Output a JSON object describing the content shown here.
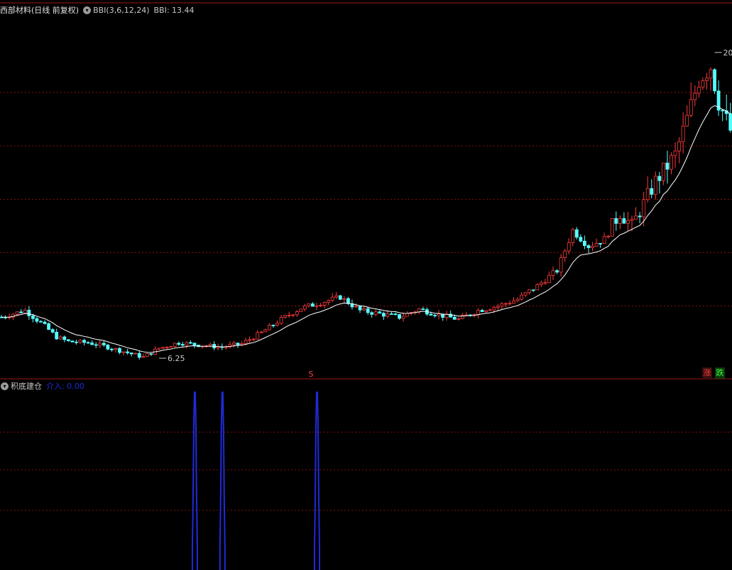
{
  "header": {
    "stock_title": "西部材料(日线 前复权)",
    "indicator_name": "BBI(3,6,12,24)",
    "indicator_value": "BBI: 13.44",
    "dropdown_icon": "chevron-down-icon"
  },
  "subpanel": {
    "title": "积底建仓",
    "legend": "介入: 0.00",
    "dropdown_icon": "chevron-down-icon"
  },
  "annotations": {
    "high_label": "20",
    "low_label": "6.25",
    "signal_marker": "S"
  },
  "footer_tags": {
    "rise": "涨",
    "fall": "跌"
  },
  "colors": {
    "background": "#000000",
    "up_candle": "#ff3b3b",
    "down_candle": "#54ffff",
    "bbi_line": "#ffffff",
    "grid": "#8b1010",
    "signal_bars": "#1e2bd8"
  },
  "chart_data": {
    "type": "candlestick",
    "indicator": "BBI",
    "price_range": [
      5.9,
      21.4
    ],
    "price_gridlines": [
      8.6,
      11.0,
      13.4,
      15.8,
      18.2
    ],
    "high": 20.0,
    "low": 6.25,
    "close_profile": [
      [
        0,
        8.1
      ],
      [
        6,
        8.4
      ],
      [
        11,
        7.7
      ],
      [
        14,
        7.2
      ],
      [
        17,
        7.0
      ],
      [
        22,
        6.95
      ],
      [
        26,
        6.8
      ],
      [
        31,
        6.55
      ],
      [
        36,
        6.3
      ],
      [
        40,
        6.7
      ],
      [
        45,
        6.95
      ],
      [
        50,
        6.85
      ],
      [
        56,
        6.75
      ],
      [
        61,
        6.9
      ],
      [
        66,
        7.4
      ],
      [
        71,
        8.0
      ],
      [
        76,
        8.5
      ],
      [
        81,
        8.75
      ],
      [
        86,
        9.0
      ],
      [
        91,
        8.4
      ],
      [
        96,
        8.25
      ],
      [
        101,
        8.1
      ],
      [
        106,
        8.45
      ],
      [
        111,
        8.2
      ],
      [
        116,
        8.0
      ],
      [
        121,
        8.4
      ],
      [
        126,
        8.6
      ],
      [
        131,
        8.9
      ],
      [
        136,
        9.5
      ],
      [
        141,
        10.2
      ],
      [
        145,
        12.0
      ],
      [
        149,
        11.3
      ],
      [
        153,
        11.6
      ],
      [
        157,
        12.8
      ],
      [
        160,
        12.2
      ],
      [
        163,
        13.2
      ],
      [
        166,
        14.2
      ],
      [
        169,
        14.9
      ],
      [
        171,
        15.4
      ],
      [
        174,
        17.0
      ],
      [
        177,
        18.8
      ],
      [
        180,
        19.4
      ],
      [
        182,
        17.8
      ],
      [
        185,
        16.5
      ]
    ],
    "signal_panel": {
      "name": "介入",
      "current_value": 0.0,
      "signal_bars_at": [
        49,
        56,
        80
      ]
    }
  }
}
